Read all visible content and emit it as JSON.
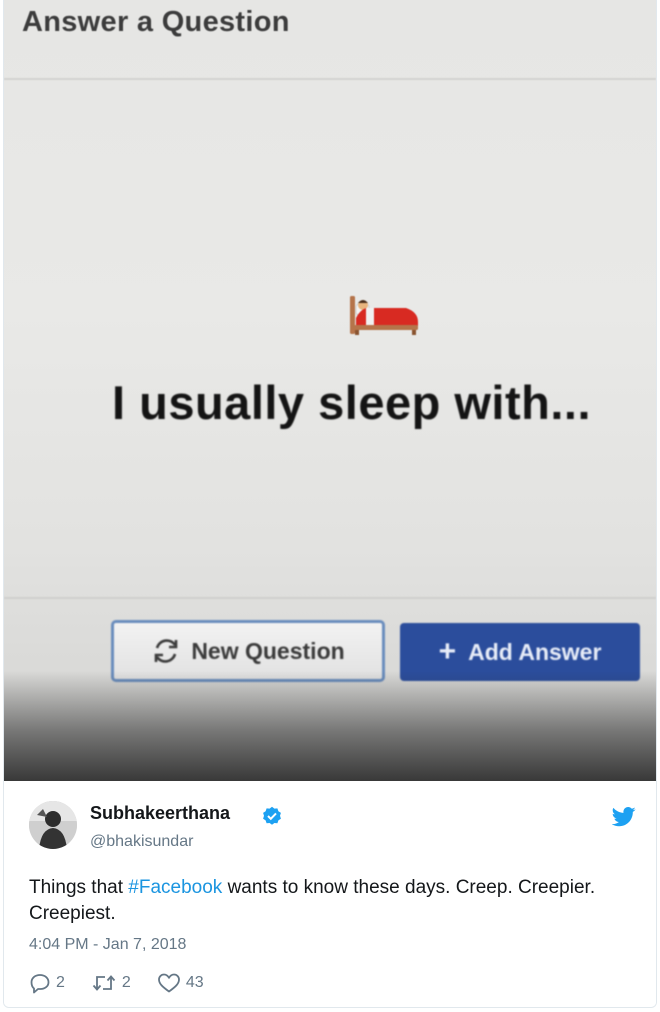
{
  "photo": {
    "title": "Answer a Question",
    "question": "I usually sleep with...",
    "question_emoji": "bed-emoji",
    "new_question_label": "New Question",
    "add_answer_label": "Add Answer",
    "colors": {
      "add_answer_bg": "#2b4d9c",
      "new_question_border": "#6a8dbd"
    }
  },
  "tweet": {
    "display_name": "Subhakeerthana",
    "handle": "@bhakisundar",
    "text_before": "Things that ",
    "hashtag": "#Facebook",
    "text_after": " wants to know these days. Creep. Creepier. Creepiest.",
    "timestamp": "4:04 PM - Jan 7, 2018",
    "replies": "2",
    "retweets": "2",
    "likes": "43",
    "colors": {
      "link": "#1b95e0",
      "verified": "#1da1f2",
      "muted": "#657786"
    }
  }
}
